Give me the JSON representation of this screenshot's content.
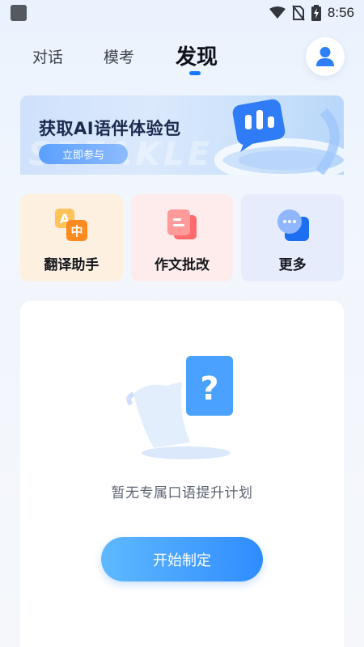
{
  "status_bar": {
    "time": "8:56"
  },
  "nav": {
    "tabs": [
      {
        "label": "对话"
      },
      {
        "label": "模考"
      },
      {
        "label": "发现"
      }
    ],
    "active_tab": "发现",
    "accent_color": "#1677ff",
    "profile_icon": "user-icon"
  },
  "banner": {
    "title": "获取AI语伴体验包",
    "button_label": "立即参与",
    "watermark": "SPEAKLE"
  },
  "tools": [
    {
      "label": "翻译助手",
      "icon": "translate-icon",
      "bg": "#fdf0e0"
    },
    {
      "label": "作文批改",
      "icon": "essay-icon",
      "bg": "#fdeceb"
    },
    {
      "label": "更多",
      "icon": "more-chat-icon",
      "bg": "#e6ecfb"
    }
  ],
  "plan": {
    "empty_text": "暂无专属口语提升计划",
    "button_label": "开始制定",
    "illustration": "question-scroll-icon"
  }
}
